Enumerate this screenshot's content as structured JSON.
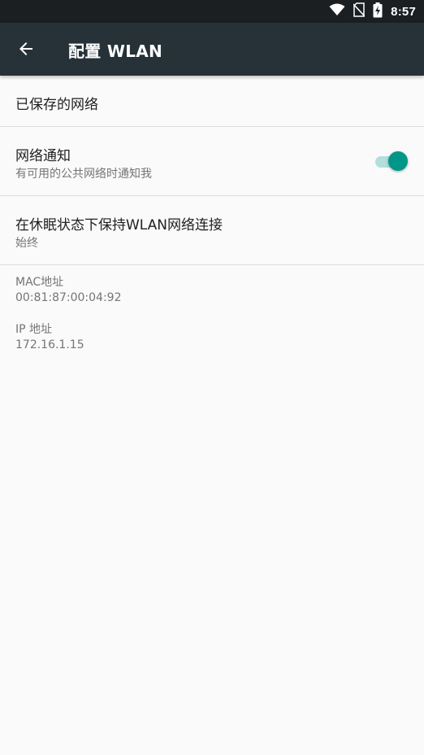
{
  "status_bar": {
    "time": "8:57",
    "icons": [
      "wifi-icon",
      "no-sim-icon",
      "battery-charging-icon"
    ]
  },
  "app_bar": {
    "title": "配置 WLAN",
    "back_icon": "arrow-back-icon"
  },
  "preferences": {
    "saved_networks": {
      "title": "已保存的网络"
    },
    "network_notification": {
      "title": "网络通知",
      "summary": "有可用的公共网络时通知我",
      "enabled": true
    },
    "keep_wifi_on_sleep": {
      "title": "在休眠状态下保持WLAN网络连接",
      "summary": "始终"
    }
  },
  "info": {
    "mac_label": "MAC地址",
    "mac_value": "00:81:87:00:04:92",
    "ip_label": "IP 地址",
    "ip_value": "172.16.1.15"
  },
  "colors": {
    "status_bar": "#1b1f22",
    "app_bar": "#263238",
    "background": "#fafafa",
    "accent": "#009688",
    "accent_track": "#b2dfdb"
  }
}
